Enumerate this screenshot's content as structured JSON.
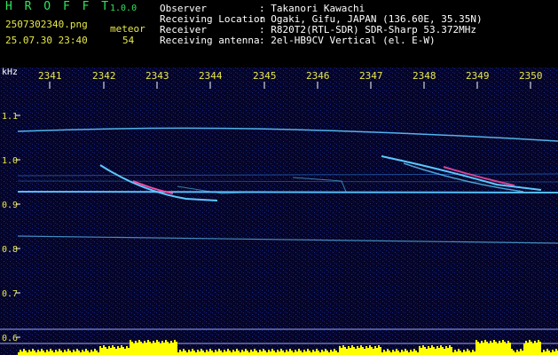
{
  "header": {
    "app_name": "H R O F F T",
    "app_version": "1.0.0",
    "filename": "2507302340.png",
    "detection_label": "meteor",
    "date_time": "25.07.30 23:40",
    "detection_count": "54"
  },
  "station_info": {
    "labels": [
      "Observer",
      "Receiving Location",
      "Receiver",
      "Receiving antenna"
    ],
    "values": [
      ": Takanori Kawachi",
      ": Ogaki, Gifu, JAPAN (136.60E, 35.35N)",
      ": R820T2(RTL-SDR) SDR-Sharp 53.372MHz",
      ": 2el-HB9CV Vertical (el. E-W)"
    ]
  },
  "plot": {
    "unit_label": "kHz",
    "time_ticks": [
      "2341",
      "2342",
      "2343",
      "2344",
      "2345",
      "2346",
      "2347",
      "2348",
      "2349",
      "2350"
    ],
    "freq_ticks": [
      "1.1",
      "1.0",
      "0.9",
      "0.8",
      "0.7",
      "0.6"
    ],
    "colors": {
      "background": "#05052a",
      "noise": "#1e3bd0",
      "echo": "#5cc8ff",
      "strong_echo": "#ff4aa0",
      "tick_text": "#e8e84a",
      "amplitude_bar": "#ffff00",
      "reference_line": "#9aa7ff"
    }
  }
}
